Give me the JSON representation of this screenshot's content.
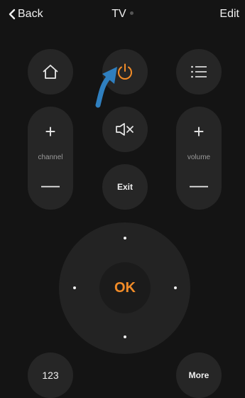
{
  "header": {
    "back_label": "Back",
    "title": "TV",
    "edit_label": "Edit"
  },
  "remote": {
    "home_icon": "home-icon",
    "power_icon": "power-icon",
    "menu_icon": "list-menu-icon",
    "channel": {
      "plus": "+",
      "label": "channel",
      "minus": "—"
    },
    "volume": {
      "plus": "+",
      "label": "volume",
      "minus": "—"
    },
    "mute_icon": "mute-speaker-icon",
    "exit_label": "Exit",
    "ok_label": "OK",
    "numbers_label": "123",
    "more_label": "More"
  },
  "colors": {
    "background": "#141414",
    "button": "#262626",
    "accent": "#f28c28",
    "pointer_arrow": "#2f7fbf"
  }
}
